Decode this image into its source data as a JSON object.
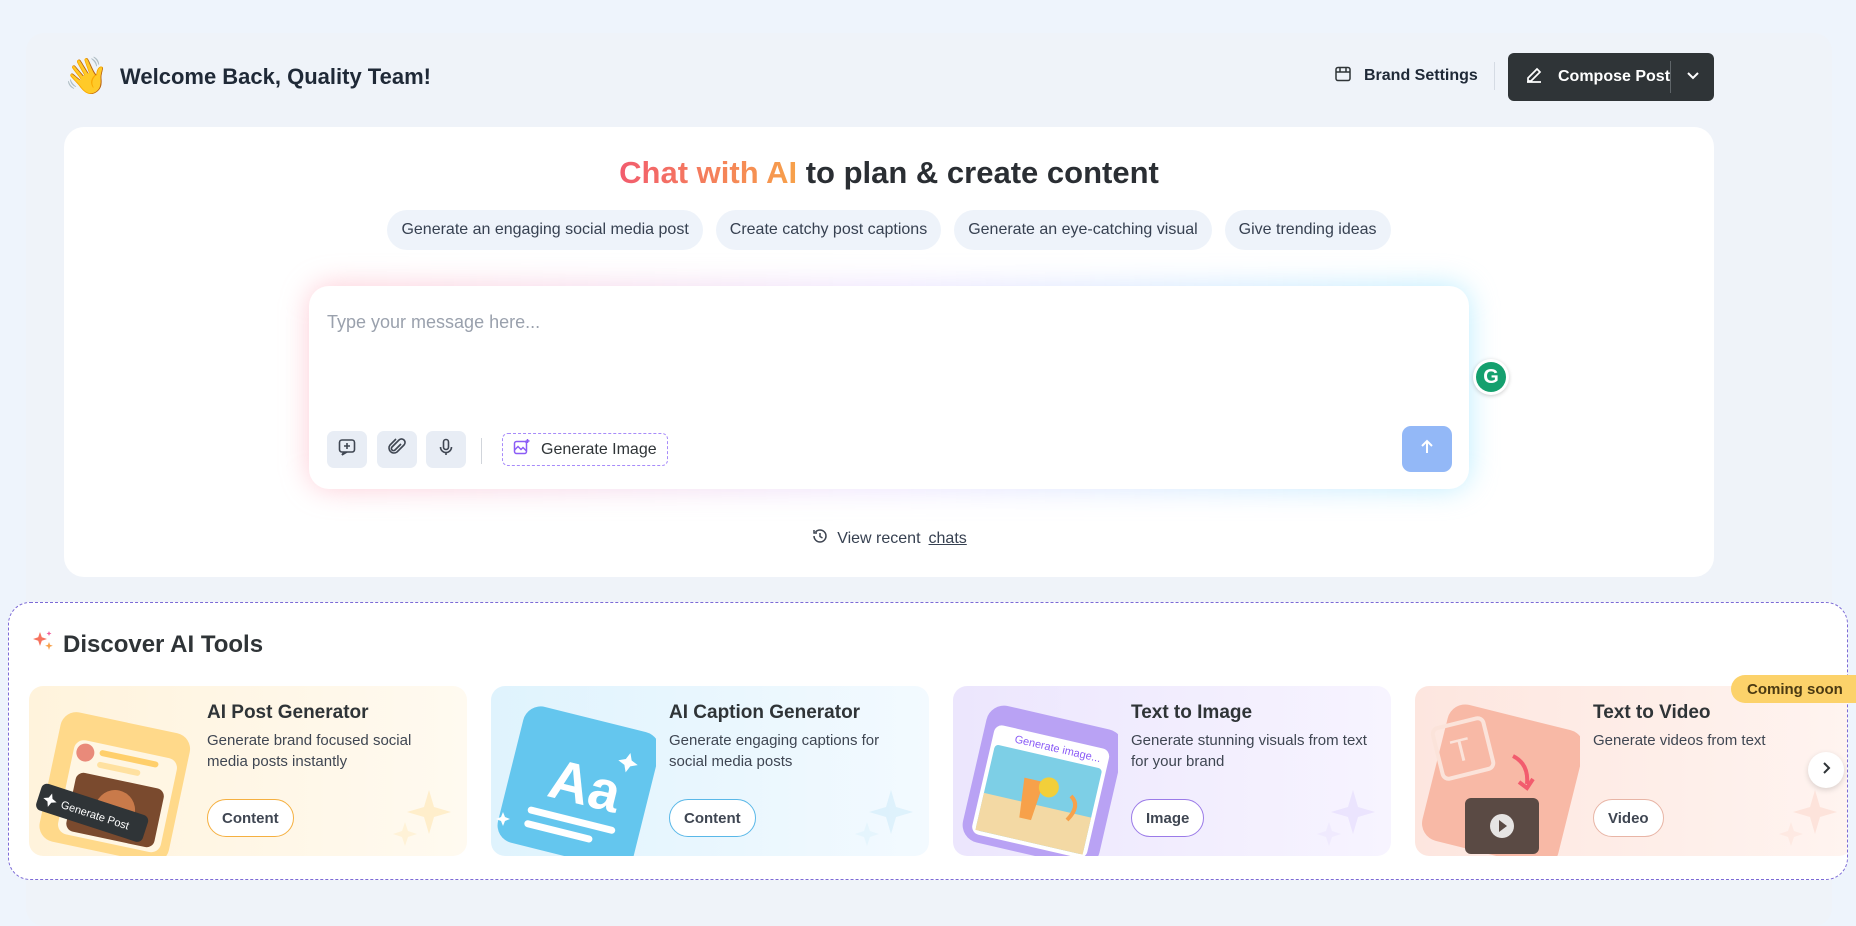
{
  "header": {
    "wave_emoji": "👋",
    "welcome": "Welcome Back, Quality Team!",
    "brand_settings_label": "Brand Settings",
    "compose_label": "Compose Post"
  },
  "chat": {
    "title_highlight": "Chat with AI",
    "title_rest": " to plan & create content",
    "suggestions": [
      "Generate an engaging social media post",
      "Create catchy post captions",
      "Generate an eye-catching visual",
      "Give trending ideas"
    ],
    "input_placeholder": "Type your message here...",
    "grammarly_letter": "G",
    "generate_image_label": "Generate Image",
    "recent_prefix": "View recent ",
    "recent_link": "chats"
  },
  "discover": {
    "title": "Discover AI Tools",
    "coming_soon": "Coming soon",
    "tools": [
      {
        "name": "AI Post Generator",
        "description": "Generate brand focused social media posts instantly",
        "tag": "Content",
        "art_label": "Generate Post",
        "accent": "#f5b041"
      },
      {
        "name": "AI Caption Generator",
        "description": "Generate engaging captions for social media posts",
        "tag": "Content",
        "art_label": "Aa",
        "accent": "#5ab8e8"
      },
      {
        "name": "Text to Image",
        "description": "Generate stunning visuals from text for your brand",
        "tag": "Image",
        "art_label": "Generate image...",
        "accent": "#9b7be8"
      },
      {
        "name": "Text to Video",
        "description": "Generate videos from text",
        "tag": "Video",
        "art_label": "T",
        "accent": "#f29a80"
      }
    ]
  },
  "colors": {
    "page_bg": "#eef4fc",
    "compose_bg": "#2f3437",
    "send_btn": "#93b8f7",
    "coming_soon": "#fcd26a"
  }
}
